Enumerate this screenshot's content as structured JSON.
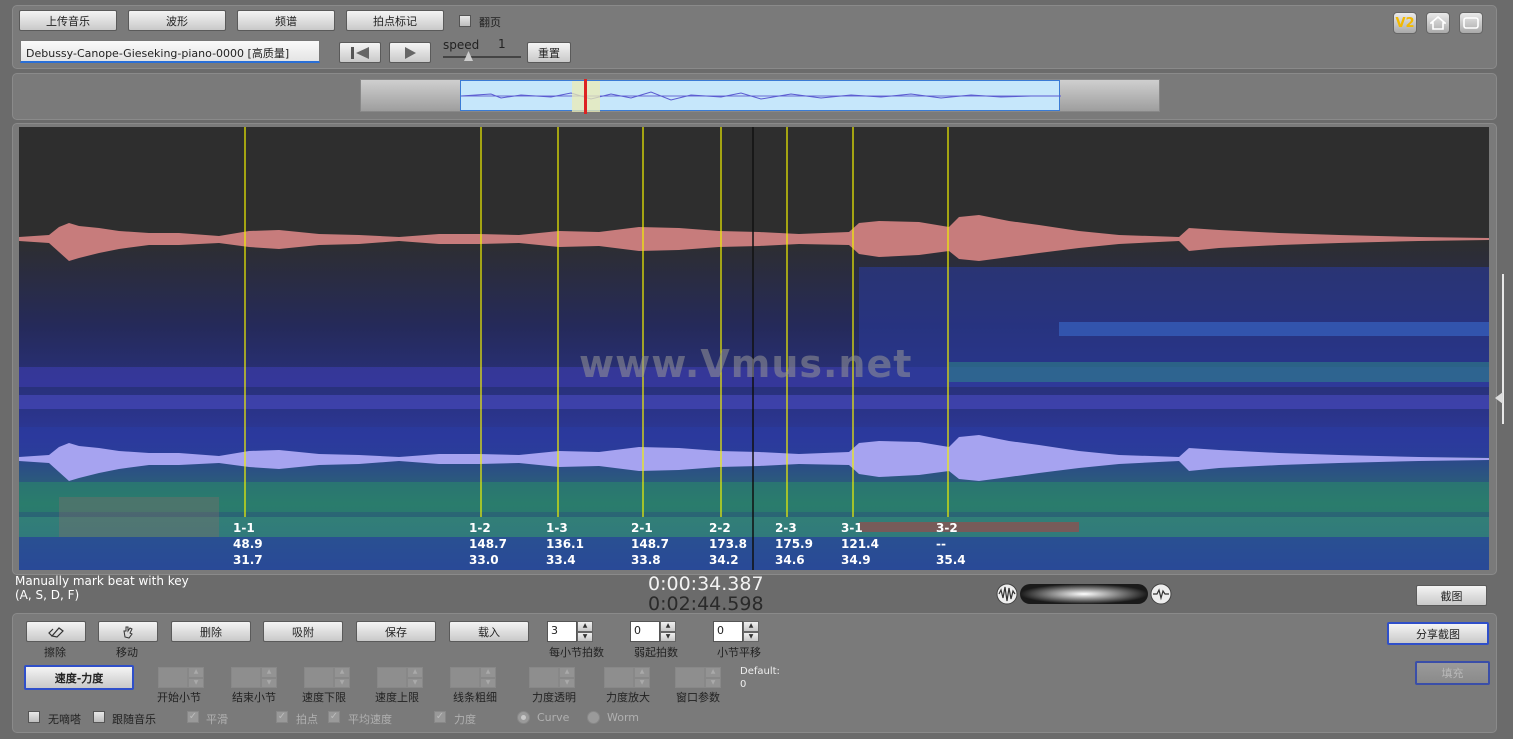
{
  "toolbar": {
    "upload_label": "上传音乐",
    "waveform_label": "波形",
    "spectrum_label": "频谱",
    "beat_mark_label": "拍点标记",
    "page_flip_label": "翻页",
    "track_name": "Debussy-Canope-Gieseking-piano-0000 [高质量]",
    "speed_label": "speed",
    "speed_value": "1",
    "reset_label": "重置"
  },
  "beats": [
    {
      "label": "1-1",
      "tempo": "48.9",
      "time": "31.7"
    },
    {
      "label": "1-2",
      "tempo": "148.7",
      "time": "33.0"
    },
    {
      "label": "1-3",
      "tempo": "136.1",
      "time": "33.4"
    },
    {
      "label": "2-1",
      "tempo": "148.7",
      "time": "33.8"
    },
    {
      "label": "2-2",
      "tempo": "173.8",
      "time": "34.2"
    },
    {
      "label": "2-3",
      "tempo": "175.9",
      "time": "34.6"
    },
    {
      "label": "3-1",
      "tempo": "121.4",
      "time": "34.9"
    },
    {
      "label": "3-2",
      "tempo": "--",
      "time": "35.4"
    }
  ],
  "watermark": "www.Vmus.net",
  "hint": {
    "line1": "Manually mark beat with key",
    "line2": "(A, S, D, F)"
  },
  "time": {
    "current": "0:00:34.387",
    "total": "0:02:44.598"
  },
  "screenshot_label": "截图",
  "share_label": "分享截图",
  "fill_label": "填充",
  "tools": {
    "erase": "擦除",
    "move": "移动",
    "delete": "删除",
    "snap": "吸附",
    "save": "保存",
    "load": "载入"
  },
  "steppers": {
    "beats_per_bar": {
      "value": "3",
      "label": "每小节拍数"
    },
    "pickup_beats": {
      "value": "0",
      "label": "弱起拍数"
    },
    "bar_offset": {
      "value": "0",
      "label": "小节平移"
    }
  },
  "mode_button": "速度-力度",
  "params": {
    "start_bar": "开始小节",
    "end_bar": "结束小节",
    "tempo_min": "速度下限",
    "tempo_max": "速度上限",
    "line_width": "线条粗细",
    "dyn_transparency": "力度透明",
    "dyn_zoom": "力度放大",
    "window_param": "窗口参数"
  },
  "default_label": "Default:",
  "default_value": "0",
  "options": {
    "no_whistle": "无嘀嗒",
    "follow_music": "跟随音乐",
    "smooth": "平滑",
    "beat_point": "拍点",
    "avg_tempo": "平均速度",
    "dynamics": "力度",
    "curve": "Curve",
    "worm": "Worm"
  },
  "badge": "V2"
}
